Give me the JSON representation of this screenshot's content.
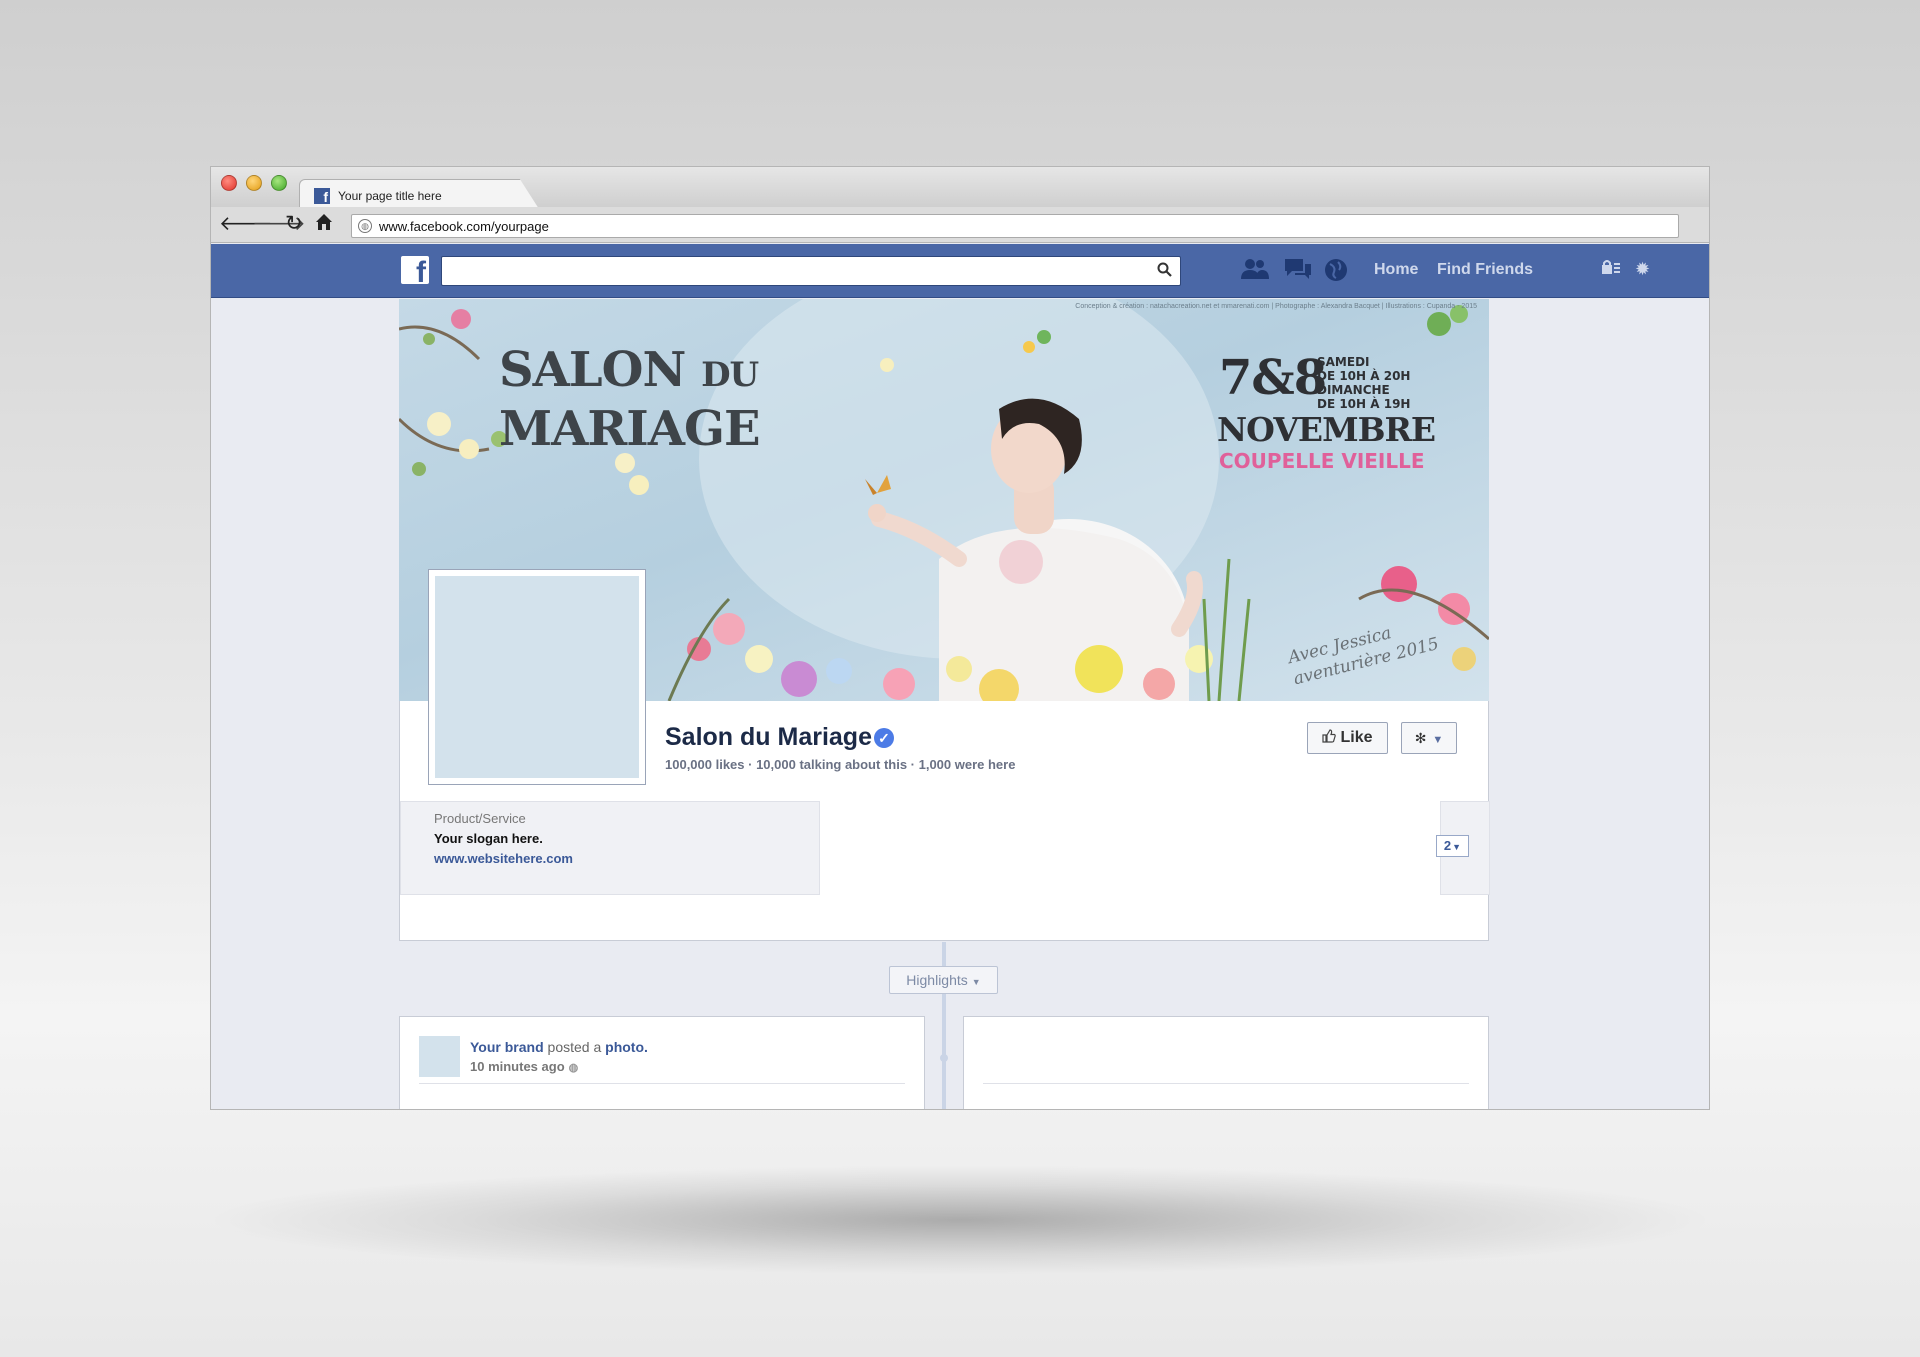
{
  "browser": {
    "tab_title": "Your page title here",
    "url": "www.facebook.com/yourpage"
  },
  "facebook_header": {
    "logo": "f",
    "links": [
      "Home",
      "Find Friends"
    ],
    "icons": [
      "friend-requests-icon",
      "messages-icon",
      "notifications-icon",
      "privacy-shortcuts-icon",
      "settings-gear-icon",
      "search-icon"
    ]
  },
  "cover": {
    "credit": "Conception & création : natachacreation.net et mmarenati.com | Photographe : Alexandra Bacquet | Illustrations : Cupanda - 2015",
    "title_line1": "SALON",
    "title_du": "DU",
    "title_line2": "MARIAGE",
    "dates": "7&8",
    "hours_line1": "SAMEDI",
    "hours_line2": "DE 10H À 20H",
    "hours_line3": "DIMANCHE",
    "hours_line4": "DE 10H À 19H",
    "month": "NOVEMBRE",
    "place": "COUPELLE VIEILLE",
    "signature_line1": "Avec Jessica",
    "signature_line2": "aventurière 2015"
  },
  "page": {
    "name": "Salon du Mariage",
    "stats": "100,000 likes · 10,000 talking about this · 1,000 were here",
    "like_label": "Like",
    "gear_symbol": "✻",
    "category": "Product/Service",
    "slogan": "Your slogan here.",
    "website": "www.websitehere.com",
    "apps_count": "2",
    "highlights_label": "Highlights"
  },
  "post": {
    "author": "Your brand",
    "verb": " posted a ",
    "object": "photo.",
    "time": "10 minutes ago"
  },
  "colors": {
    "facebook_blue": "#4a67a6",
    "link_blue": "#3b5998",
    "cover_sky": "#c4d9e6",
    "place_pink": "#e0609a"
  }
}
